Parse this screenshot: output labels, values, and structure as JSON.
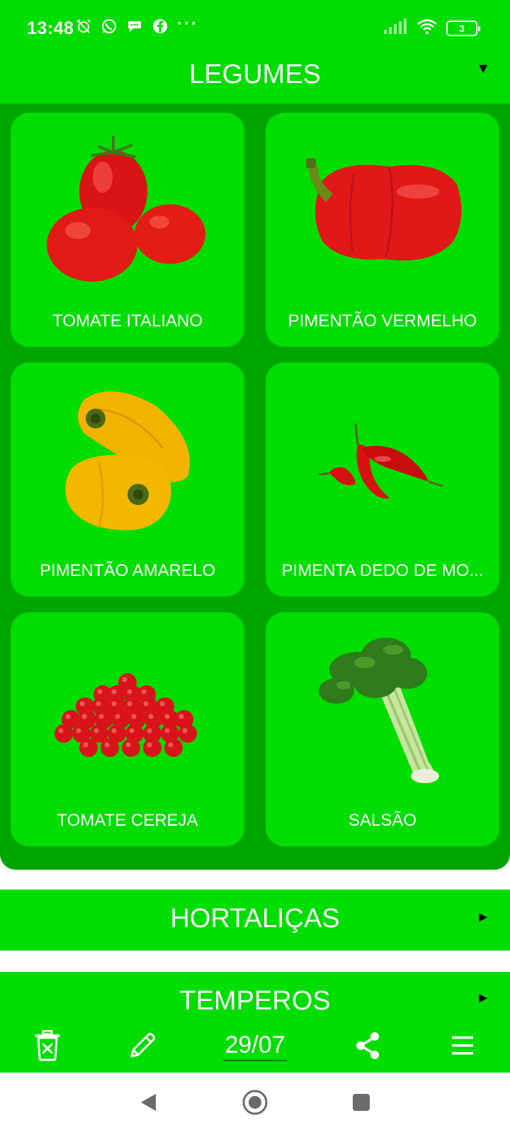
{
  "status_bar": {
    "time": "13:48",
    "icons_left": [
      "alarm-off-icon",
      "whatsapp-icon",
      "chat-icon",
      "facebook-icon"
    ],
    "more": "···",
    "battery": "3"
  },
  "categories": {
    "legumes": {
      "title": "LEGUMES",
      "arrow": "▼"
    },
    "hortalicas": {
      "title": "HORTALIÇAS",
      "arrow": "►"
    },
    "temperos": {
      "title": "TEMPEROS",
      "arrow": "►"
    }
  },
  "items": [
    {
      "label": "TOMATE ITALIANO",
      "icon": "roma-tomato-image"
    },
    {
      "label": "PIMENTÃO VERMELHO",
      "icon": "red-bell-pepper-image"
    },
    {
      "label": "PIMENTÃO AMARELO",
      "icon": "yellow-bell-pepper-image"
    },
    {
      "label": "PIMENTA DEDO DE MO...",
      "icon": "red-chili-pepper-image"
    },
    {
      "label": "TOMATE CEREJA",
      "icon": "cherry-tomato-image"
    },
    {
      "label": "SALSÃO",
      "icon": "celery-image"
    }
  ],
  "toolbar": {
    "date": "29/07",
    "icons": [
      "delete-list-icon",
      "edit-icon",
      "share-icon",
      "menu-icon"
    ]
  },
  "colors": {
    "primary": "#00dd00",
    "panel": "#00a500"
  }
}
